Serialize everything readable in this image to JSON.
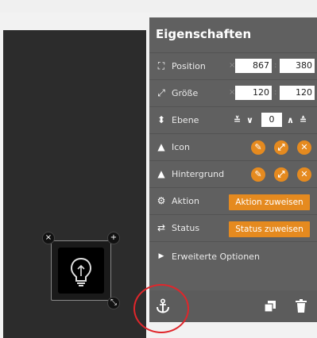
{
  "panel": {
    "title": "Eigenschaften",
    "position": {
      "label": "Position",
      "x": "867",
      "y": "380"
    },
    "size": {
      "label": "Größe",
      "width": "120",
      "height": "120"
    },
    "layer": {
      "label": "Ebene",
      "value": "0"
    },
    "icon": {
      "label": "Icon"
    },
    "background": {
      "label": "Hintergrund"
    },
    "action": {
      "label": "Aktion",
      "button": "Aktion zuweisen"
    },
    "status": {
      "label": "Status",
      "button": "Status zuweisen"
    },
    "advanced": {
      "label": "Erweiterte Optionen"
    }
  },
  "icons": {
    "position": "move-icon",
    "size": "resize-icon",
    "layer": "layers-icon",
    "icon": "image-icon",
    "background": "image-icon",
    "action": "gear-icon",
    "status": "swap-icon",
    "anchor": "anchor-icon",
    "copy": "copy-icon",
    "delete": "trash-icon",
    "widget": "lightbulb-icon"
  },
  "colors": {
    "accent": "#e58a1f",
    "panel": "#606060",
    "canvas": "#2c2c2c",
    "highlight": "#e0262b"
  }
}
